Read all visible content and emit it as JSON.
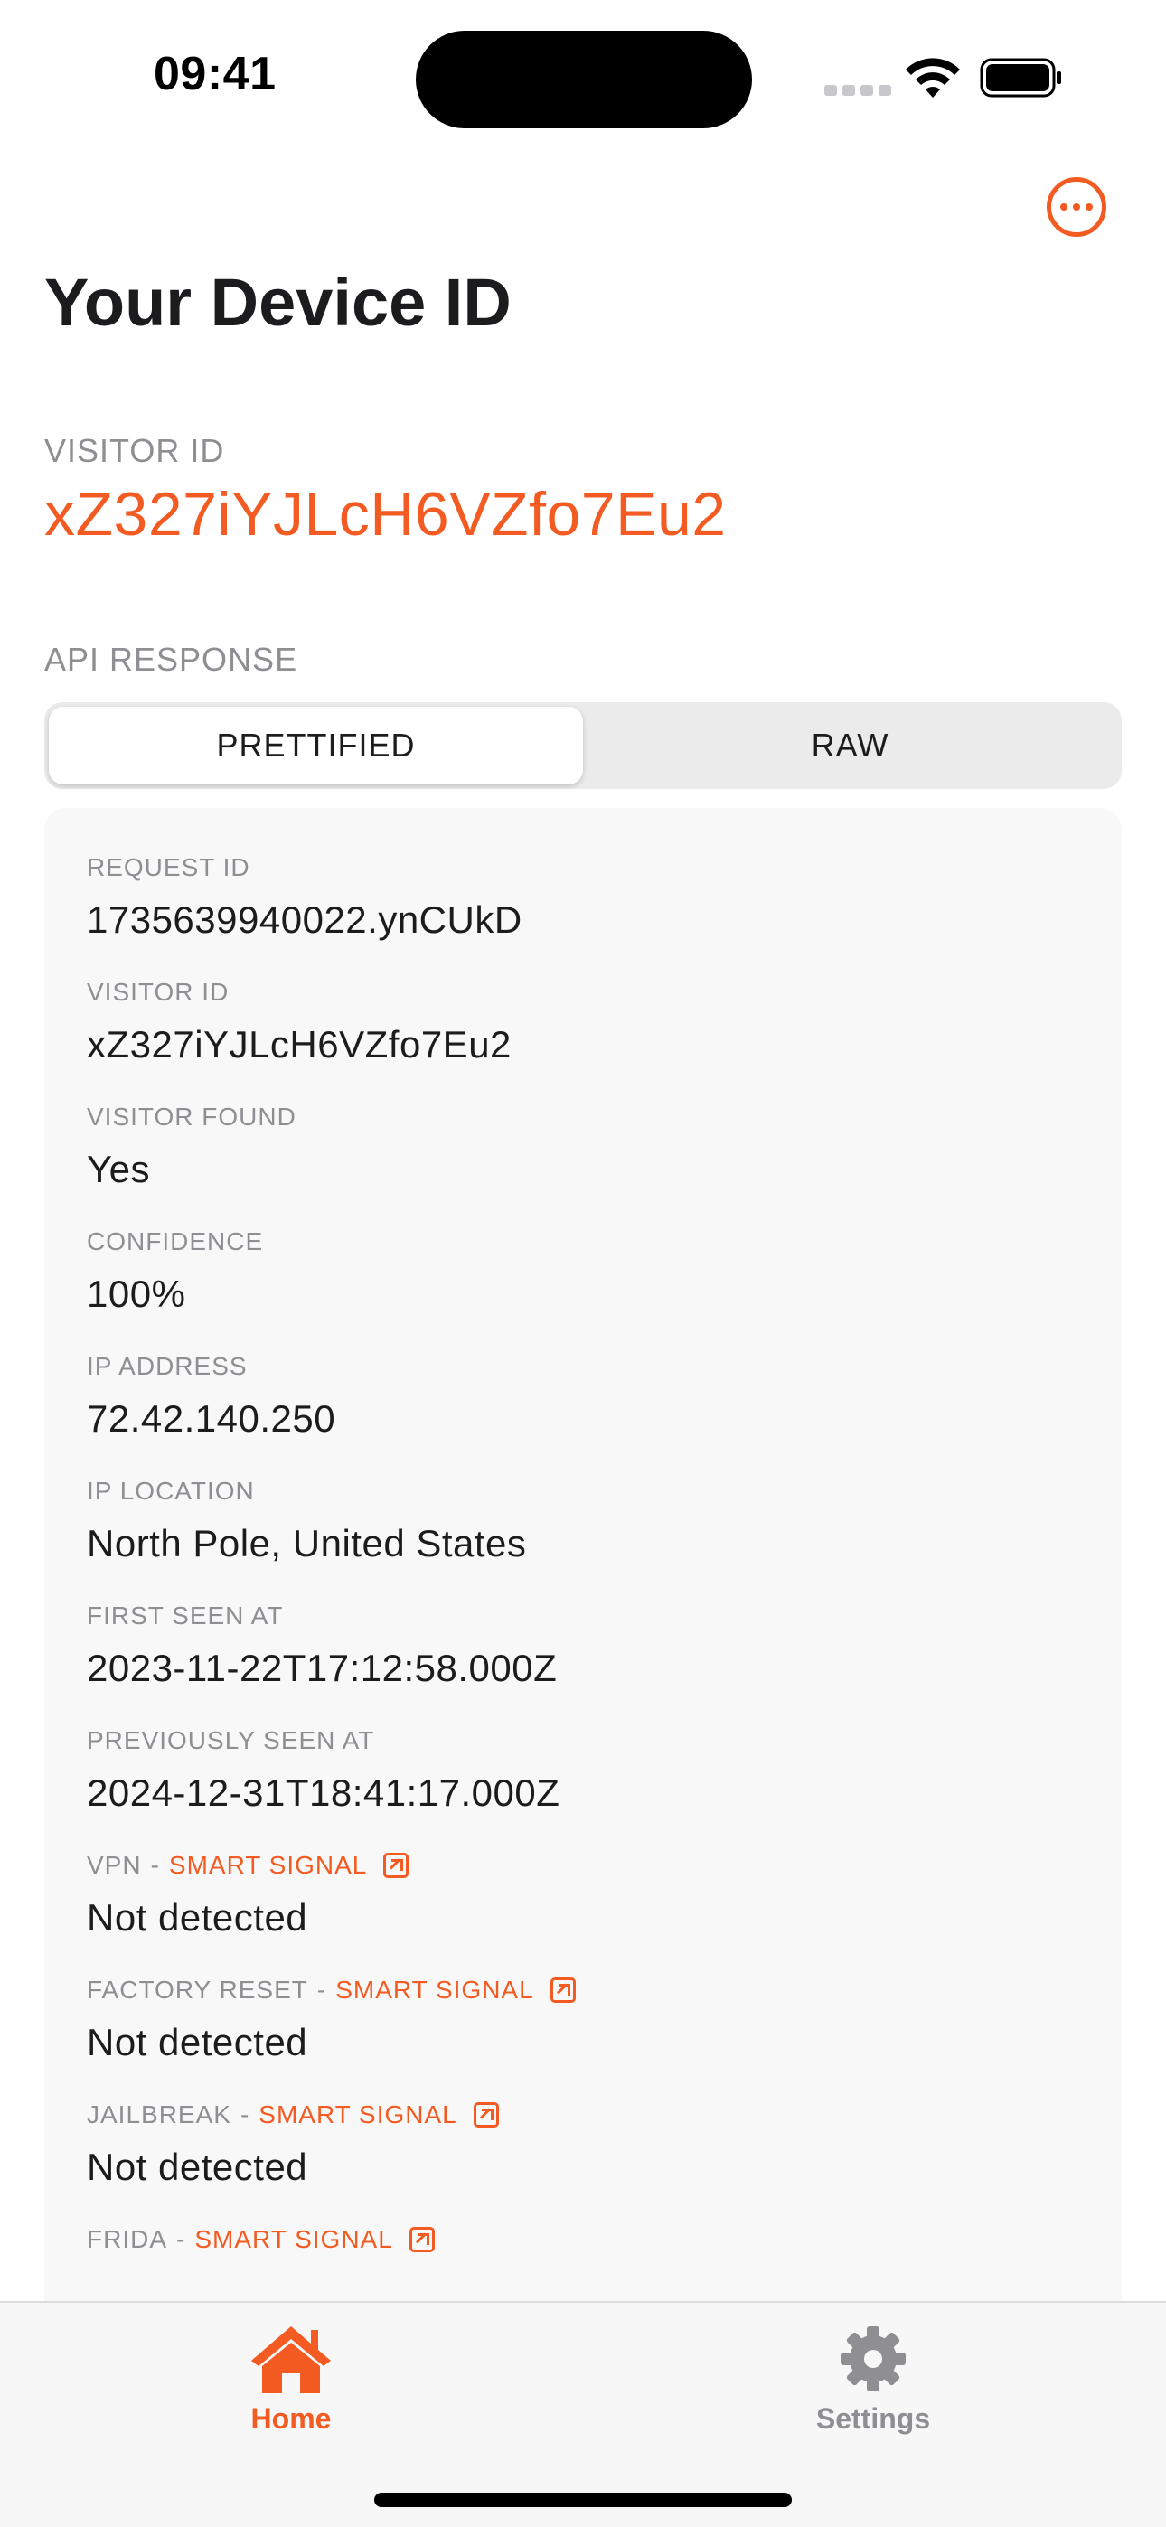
{
  "status_bar": {
    "time": "09:41"
  },
  "header": {
    "title": "Your Device ID",
    "more_icon": "ellipsis-circle-icon"
  },
  "visitor": {
    "label": "VISITOR ID",
    "value": "xZ327iYJLcH6VZfo7Eu2"
  },
  "api_response": {
    "label": "API RESPONSE",
    "tabs": [
      {
        "label": "PRETTIFIED",
        "active": true
      },
      {
        "label": "RAW",
        "active": false
      }
    ],
    "fields": [
      {
        "label": "REQUEST ID",
        "value": "1735639940022.ynCUkD"
      },
      {
        "label": "VISITOR ID",
        "value": "xZ327iYJLcH6VZfo7Eu2"
      },
      {
        "label": "VISITOR FOUND",
        "value": "Yes"
      },
      {
        "label": "CONFIDENCE",
        "value": "100%"
      },
      {
        "label": "IP ADDRESS",
        "value": "72.42.140.250"
      },
      {
        "label": "IP LOCATION",
        "value": "North Pole, United States"
      },
      {
        "label": "FIRST SEEN AT",
        "value": "2023-11-22T17:12:58.000Z"
      },
      {
        "label": "PREVIOUSLY SEEN AT",
        "value": "2024-12-31T18:41:17.000Z"
      },
      {
        "label": "VPN",
        "smart": "SMART SIGNAL",
        "value": "Not detected"
      },
      {
        "label": "FACTORY RESET",
        "smart": "SMART SIGNAL",
        "value": "Not detected"
      },
      {
        "label": "JAILBREAK",
        "smart": "SMART SIGNAL",
        "value": "Not detected"
      },
      {
        "label": "FRIDA",
        "smart": "SMART SIGNAL",
        "value": ""
      }
    ],
    "smart_separator": "-"
  },
  "tab_bar": {
    "items": [
      {
        "label": "Home",
        "icon": "house-icon",
        "active": true
      },
      {
        "label": "Settings",
        "icon": "gear-icon",
        "active": false
      }
    ]
  },
  "colors": {
    "accent": "#f35b22",
    "secondary_text": "#8e8e93"
  }
}
